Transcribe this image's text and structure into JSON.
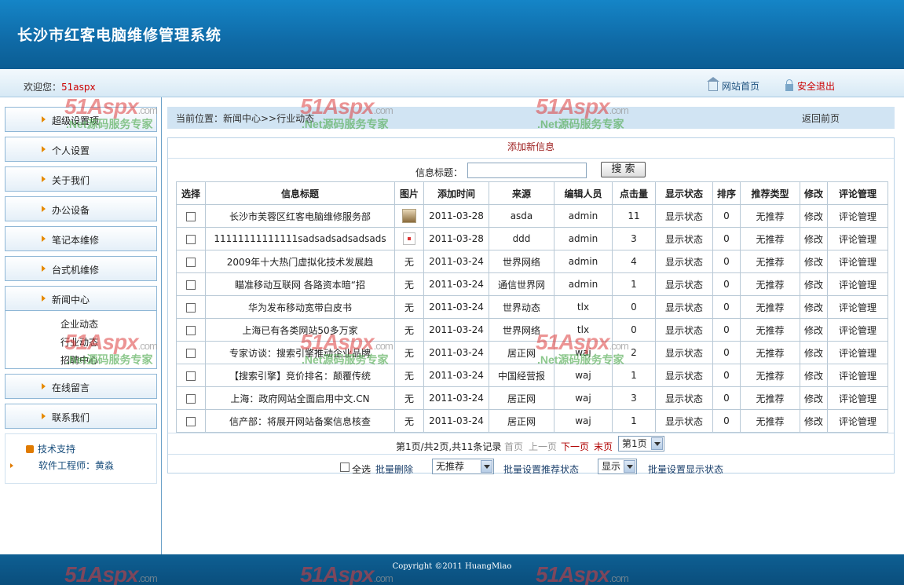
{
  "header": {
    "title": "长沙市红客电脑维修管理系统"
  },
  "welcome": {
    "label": "欢迎您：",
    "user": "51aspx",
    "home": "网站首页",
    "logout": "安全退出"
  },
  "sidebar": {
    "items": [
      {
        "label": "超级设置项"
      },
      {
        "label": "个人设置"
      },
      {
        "label": "关于我们"
      },
      {
        "label": "办公设备"
      },
      {
        "label": "笔记本维修"
      },
      {
        "label": "台式机维修"
      },
      {
        "label": "新闻中心"
      }
    ],
    "sub_items": [
      {
        "label": "企业动态"
      },
      {
        "label": "行业动态"
      },
      {
        "label": "招聘中心"
      }
    ],
    "items_after": [
      {
        "label": "在线留言"
      },
      {
        "label": "联系我们"
      }
    ],
    "support": {
      "title": "技术支持",
      "engineer": "软件工程师：黄淼"
    }
  },
  "breadcrumb": {
    "location": "当前位置：新闻中心>>行业动态",
    "back": "返回前页"
  },
  "main": {
    "add_new": "添加新信息",
    "search": {
      "label": "信息标题：",
      "value": "",
      "button": "搜 索"
    },
    "table": {
      "headers": [
        "选择",
        "信息标题",
        "图片",
        "添加时间",
        "来源",
        "编辑人员",
        "点击量",
        "显示状态",
        "排序",
        "推荐类型",
        "修改",
        "评论管理"
      ],
      "rows": [
        [
          "",
          "长沙市芙蓉区红客电脑维修服务部",
          "",
          "2011-03-28",
          "asda",
          "admin",
          "11",
          "显示状态",
          "0",
          "无推荐",
          "修改",
          "评论管理"
        ],
        [
          "",
          "11111111111111sadsadsadsadsads",
          "",
          "2011-03-28",
          "ddd",
          "admin",
          "3",
          "显示状态",
          "0",
          "无推荐",
          "修改",
          "评论管理"
        ],
        [
          "",
          "2009年十大热门虚拟化技术发展趋",
          "无",
          "2011-03-24",
          "世界网络",
          "admin",
          "4",
          "显示状态",
          "0",
          "无推荐",
          "修改",
          "评论管理"
        ],
        [
          "",
          "瞄准移动互联网 各路资本暗“招",
          "无",
          "2011-03-24",
          "通信世界网",
          "admin",
          "1",
          "显示状态",
          "0",
          "无推荐",
          "修改",
          "评论管理"
        ],
        [
          "",
          "华为发布移动宽带白皮书",
          "无",
          "2011-03-24",
          "世界动态",
          "tlx",
          "0",
          "显示状态",
          "0",
          "无推荐",
          "修改",
          "评论管理"
        ],
        [
          "",
          "上海已有各类网站50多万家",
          "无",
          "2011-03-24",
          "世界网络",
          "tlx",
          "0",
          "显示状态",
          "0",
          "无推荐",
          "修改",
          "评论管理"
        ],
        [
          "",
          "专家访谈：搜索引擎推动企业品牌",
          "无",
          "2011-03-24",
          "居正网",
          "waj",
          "2",
          "显示状态",
          "0",
          "无推荐",
          "修改",
          "评论管理"
        ],
        [
          "",
          "【搜索引擎】竞价排名：颠覆传统",
          "无",
          "2011-03-24",
          "中国经营报",
          "waj",
          "1",
          "显示状态",
          "0",
          "无推荐",
          "修改",
          "评论管理"
        ],
        [
          "",
          "上海：政府网站全面启用中文.CN",
          "无",
          "2011-03-24",
          "居正网",
          "waj",
          "3",
          "显示状态",
          "0",
          "无推荐",
          "修改",
          "评论管理"
        ],
        [
          "",
          "信产部：将展开网站备案信息核查",
          "无",
          "2011-03-24",
          "居正网",
          "waj",
          "1",
          "显示状态",
          "0",
          "无推荐",
          "修改",
          "评论管理"
        ]
      ],
      "pic_icons": [
        "photo-thumbnail-icon",
        "broken-image-icon"
      ]
    },
    "pager": {
      "info": "第1页/共2页,共11条记录",
      "first": "首页",
      "prev": "上一页",
      "next": "下一页",
      "last": "末页",
      "page_select": "第1页"
    },
    "batch": {
      "select_all": "全选",
      "batch_delete": "批量删除",
      "recommend_select": "无推荐",
      "set_recommend": "批量设置推荐状态",
      "display_select": "显示",
      "set_display": "批量设置显示状态"
    }
  },
  "footer": {
    "copyright": "Copyright ©2011 HuangMiao"
  },
  "watermark": {
    "logo": "51Aspx",
    "domain": ".com",
    "slogan": ".Net源码服务专家"
  },
  "colors": {
    "header_blue": "#0f6aa6",
    "link_red": "#c00000",
    "accent_orange": "#e68a00"
  }
}
